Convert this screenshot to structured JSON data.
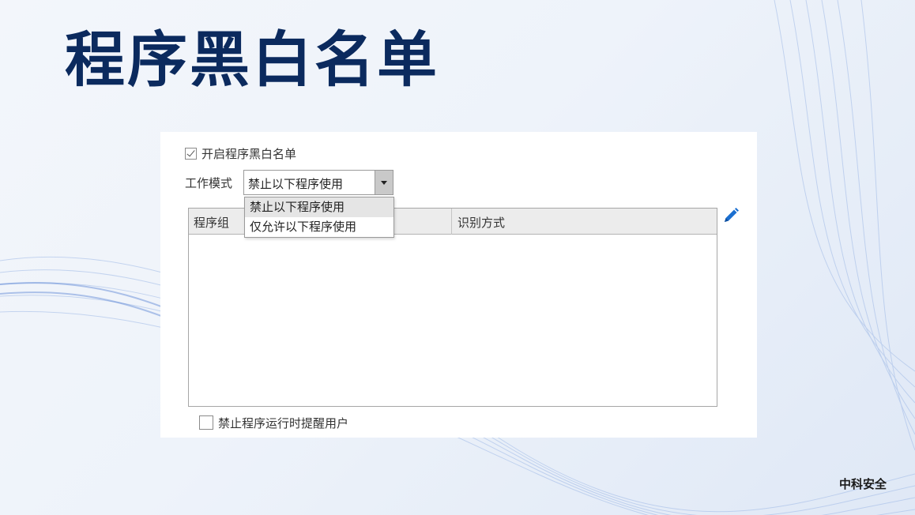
{
  "slide": {
    "title": "程序黑白名单",
    "brand": "中科安全"
  },
  "settings": {
    "enable_label": "开启程序黑白名单",
    "enable_checked": true,
    "mode_label": "工作模式",
    "mode_selected": "禁止以下程序使用",
    "mode_options": [
      "禁止以下程序使用",
      "仅允许以下程序使用"
    ],
    "notify_label": "禁止程序运行时提醒用户",
    "notify_checked": false
  },
  "table": {
    "columns": [
      "程序组",
      "识别方式"
    ],
    "rows": []
  },
  "icons": {
    "edit": "pencil-icon",
    "checkbox_checked": "checkmark-icon",
    "dropdown_arrow": "caret-down-icon"
  },
  "colors": {
    "title": "#0b2a5e",
    "edit_icon": "#1b6fd0",
    "highlight": "#e5e5e5"
  }
}
